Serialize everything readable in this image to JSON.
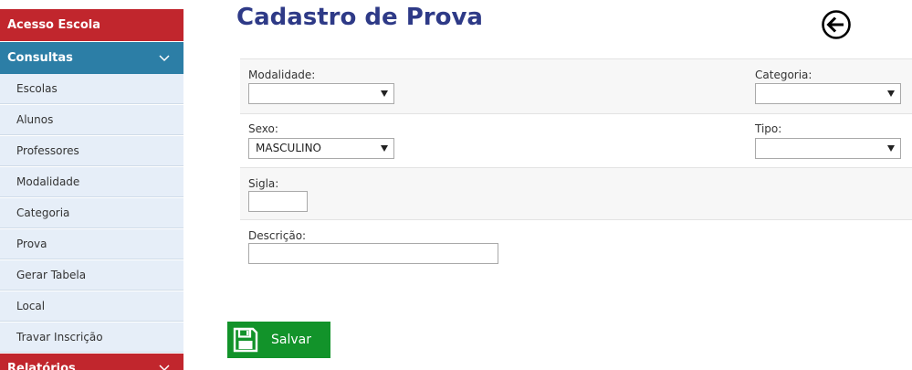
{
  "sidebar": {
    "acesso_escola": "Acesso Escola",
    "consultas": "Consultas",
    "relatorios": "Relatórios",
    "items": [
      {
        "label": "Escolas"
      },
      {
        "label": "Alunos"
      },
      {
        "label": "Professores"
      },
      {
        "label": "Modalidade"
      },
      {
        "label": "Categoria"
      },
      {
        "label": "Prova"
      },
      {
        "label": "Gerar Tabela"
      },
      {
        "label": "Local"
      },
      {
        "label": "Travar Inscrição"
      }
    ]
  },
  "page": {
    "title": "Cadastro de Prova",
    "back_icon": "arrow-left-circle-icon"
  },
  "form": {
    "modalidade": {
      "label": "Modalidade:",
      "value": ""
    },
    "categoria": {
      "label": "Categoria:",
      "value": ""
    },
    "sexo": {
      "label": "Sexo:",
      "value": "MASCULINO"
    },
    "tipo": {
      "label": "Tipo:",
      "value": ""
    },
    "sigla": {
      "label": "Sigla:",
      "value": ""
    },
    "descricao": {
      "label": "Descrição:",
      "value": ""
    }
  },
  "actions": {
    "save_label": "Salvar",
    "save_icon": "floppy-disk-icon"
  },
  "colors": {
    "red_header": "#c1262d",
    "blue_header": "#2c7ea6",
    "sidebar_item_bg": "#e6eef8",
    "title": "#2e3a87",
    "save_button": "#12932a"
  }
}
